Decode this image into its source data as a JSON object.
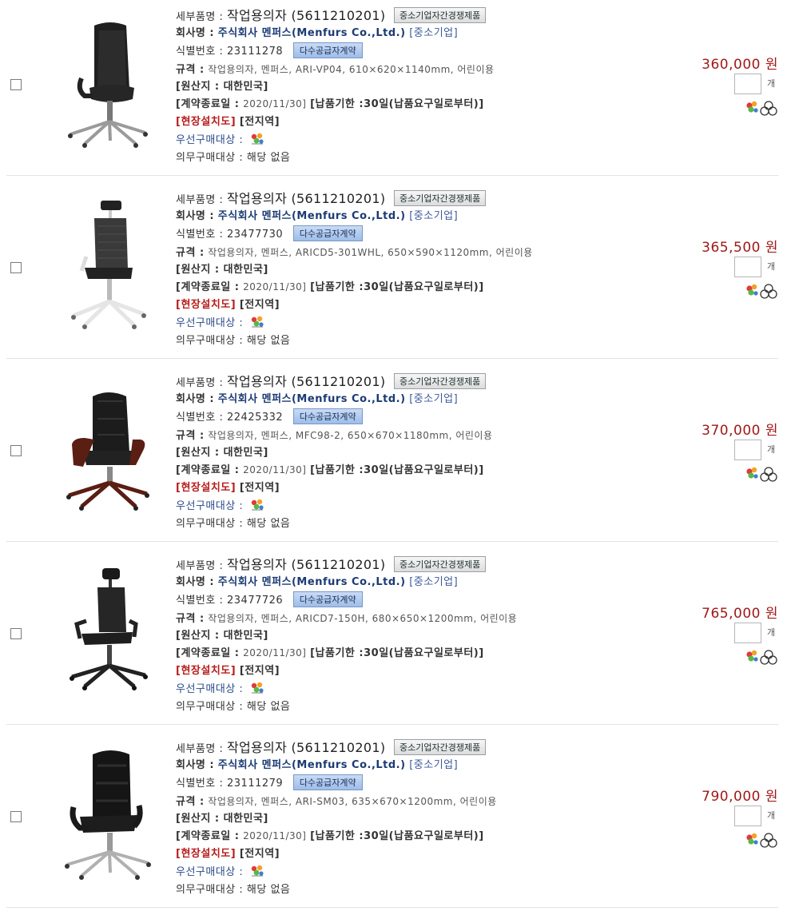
{
  "labels": {
    "detail_name": "세부품명 :",
    "company": "회사명 :",
    "id_no": "식별번호 :",
    "spec": "규격 :",
    "origin": "[원산지 : 대한민국]",
    "contract_end": "[계약종료일 :",
    "delivery": "[납품기한 :30일(납품요구일로부터)]",
    "install": "[현장설치도]",
    "region": "[전지역]",
    "priority": "우선구매대상 :",
    "mandatory": "의무구매대상 : 해당 없음",
    "unit": "개"
  },
  "items": [
    {
      "product_name": "작업용의자 (5611210201)",
      "badge_competition": "중소기업자간경쟁제품",
      "company": "주식회사 멘퍼스(Menfurs Co.,Ltd.)",
      "company_type": "[중소기업]",
      "id_number": "23111278",
      "badge_contract": "다수공급자계약",
      "spec": "작업용의자, 멘퍼스, ARI-VP04, 610×620×1140mm, 어린이용",
      "contract_end_date": "2020/11/30]",
      "price": "360,000 원",
      "chair": "black-leather-exec"
    },
    {
      "product_name": "작업용의자 (5611210201)",
      "badge_competition": "중소기업자간경쟁제품",
      "company": "주식회사 멘퍼스(Menfurs Co.,Ltd.)",
      "company_type": "[중소기업]",
      "id_number": "23477730",
      "badge_contract": "다수공급자계약",
      "spec": "작업용의자, 멘퍼스, ARICD5-301WHL, 650×590×1120mm, 어린이용",
      "contract_end_date": "2020/11/30]",
      "price": "365,500 원",
      "chair": "mesh-white"
    },
    {
      "product_name": "작업용의자 (5611210201)",
      "badge_competition": "중소기업자간경쟁제품",
      "company": "주식회사 멘퍼스(Menfurs Co.,Ltd.)",
      "company_type": "[중소기업]",
      "id_number": "22425332",
      "badge_contract": "다수공급자계약",
      "spec": "작업용의자, 멘퍼스, MFC98-2, 650×670×1180mm, 어린이용",
      "contract_end_date": "2020/11/30]",
      "price": "370,000 원",
      "chair": "leather-wood-arm"
    },
    {
      "product_name": "작업용의자 (5611210201)",
      "badge_competition": "중소기업자간경쟁제품",
      "company": "주식회사 멘퍼스(Menfurs Co.,Ltd.)",
      "company_type": "[중소기업]",
      "id_number": "23477726",
      "badge_contract": "다수공급자계약",
      "spec": "작업용의자, 멘퍼스, ARICD7-150H, 680×650×1200mm, 어린이용",
      "contract_end_date": "2020/11/30]",
      "price": "765,000 원",
      "chair": "mesh-black-headrest"
    },
    {
      "product_name": "작업용의자 (5611210201)",
      "badge_competition": "중소기업자간경쟁제품",
      "company": "주식회사 멘퍼스(Menfurs Co.,Ltd.)",
      "company_type": "[중소기업]",
      "id_number": "23111279",
      "badge_contract": "다수공급자계약",
      "spec": "작업용의자, 멘퍼스, ARI-SM03, 635×670×1200mm, 어린이용",
      "contract_end_date": "2020/11/30]",
      "price": "790,000 원",
      "chair": "black-leather-highback"
    }
  ]
}
